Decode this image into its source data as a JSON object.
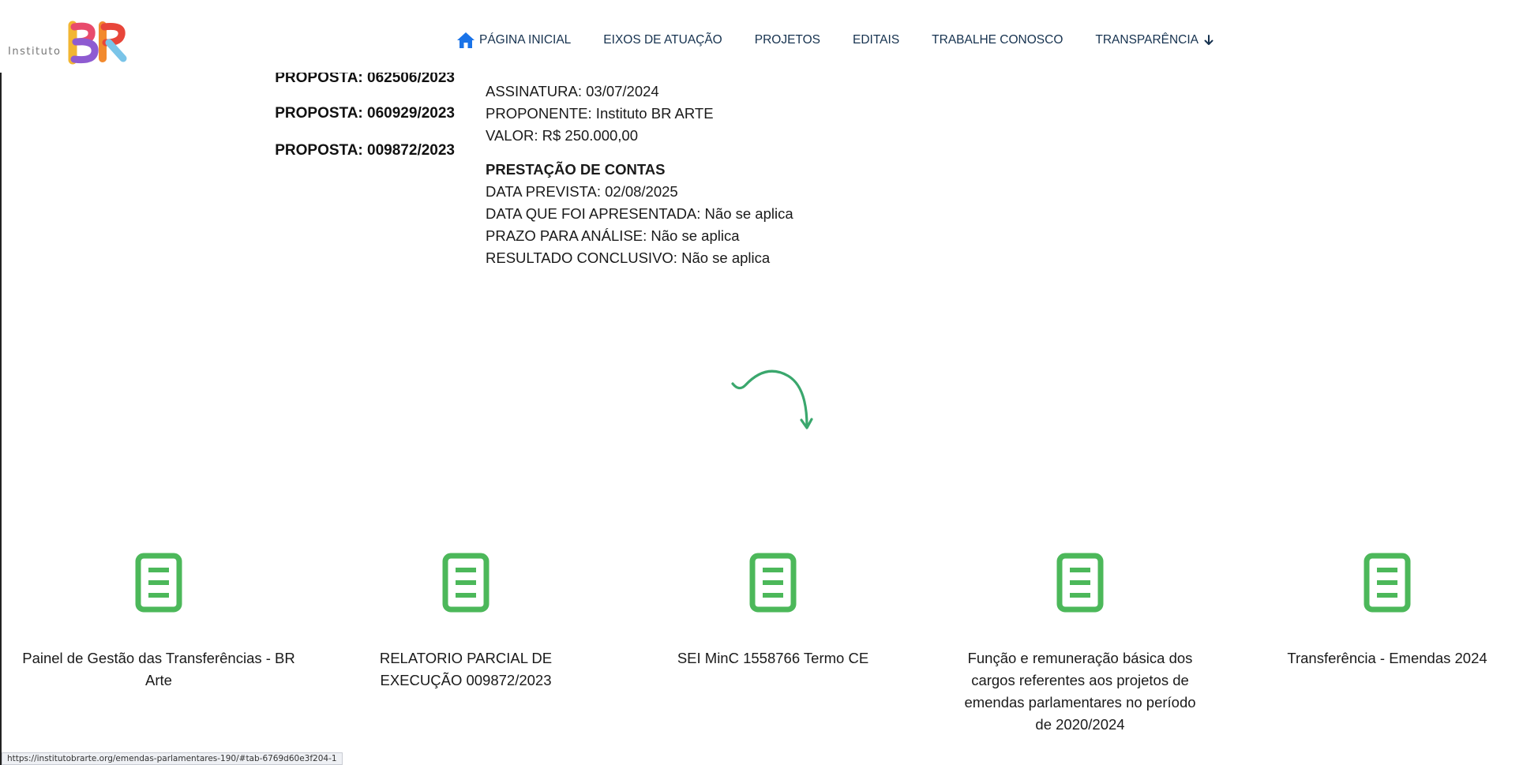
{
  "header": {
    "logo_text": "Instituto",
    "nav": [
      {
        "label": "PÁGINA INICIAL",
        "icon": "home-icon"
      },
      {
        "label": "EIXOS DE ATUAÇÃO"
      },
      {
        "label": "PROJETOS"
      },
      {
        "label": "EDITAIS"
      },
      {
        "label": "TRABALHE CONOSCO"
      },
      {
        "label": "TRANSPARÊNCIA",
        "icon": "arrow-down-icon"
      }
    ]
  },
  "proposals": [
    "PROPOSTA: 062506/2023",
    "PROPOSTA: 060929/2023",
    "PROPOSTA: 009872/2023"
  ],
  "details": {
    "assinatura": "ASSINATURA: 03/07/2024",
    "proponente": "PROPONENTE: Instituto BR ARTE",
    "valor": "VALOR: R$ 250.000,00",
    "prestacao_heading": "PRESTAÇÃO DE CONTAS",
    "data_prevista": "DATA PREVISTA: 02/08/2025",
    "data_apresentada": "DATA QUE FOI APRESENTADA: Não se aplica",
    "prazo": "PRAZO PARA ANÁLISE: Não se aplica",
    "resultado": "RESULTADO CONCLUSIVO: Não se aplica"
  },
  "downloads": [
    {
      "label": "Painel de Gestão das Transferências - BR Arte",
      "icon": "document-icon"
    },
    {
      "label": "RELATORIO PARCIAL DE EXECUÇÃO 009872/2023",
      "icon": "document-icon"
    },
    {
      "label": "SEI MinC 1558766 Termo CE",
      "icon": "document-icon"
    },
    {
      "label": "Função e remuneração básica dos cargos referentes aos projetos de emendas parlamentares no período de 2020/2024",
      "icon": "document-icon"
    },
    {
      "label": "Transferência - Emendas 2024",
      "icon": "document-icon"
    }
  ],
  "status_bar": "https://institutobrarte.org/emendas-parlamentares-190/#tab-6769d60e3f204-1",
  "colors": {
    "nav_text": "#16324f",
    "home_icon": "#1a73e8",
    "doc_icon": "#4cb85a",
    "arrow": "#3aa76d"
  }
}
